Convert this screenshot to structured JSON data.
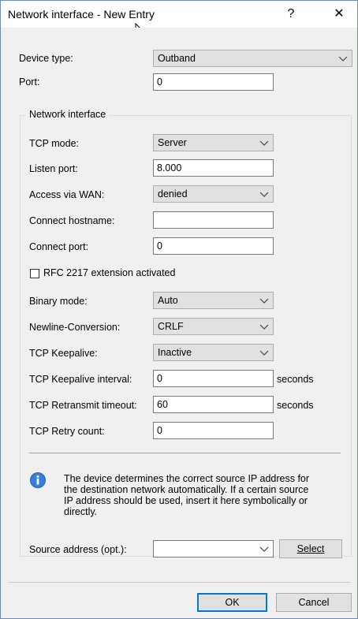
{
  "window": {
    "title": "Network interface - New Entry",
    "help_label": "?",
    "close_label": "✕"
  },
  "device_type": {
    "label": "Device type:",
    "value": "Outband"
  },
  "port": {
    "label": "Port:",
    "value": "0"
  },
  "group": {
    "title": "Network interface",
    "tcp_mode": {
      "label": "TCP mode:",
      "value": "Server"
    },
    "listen_port": {
      "label": "Listen port:",
      "value": "8.000"
    },
    "access_wan": {
      "label": "Access via WAN:",
      "value": "denied"
    },
    "connect_hostname": {
      "label": "Connect hostname:",
      "value": ""
    },
    "connect_port": {
      "label": "Connect port:",
      "value": "0"
    },
    "rfc2217": {
      "label": "RFC 2217 extension activated",
      "checked": false
    },
    "binary_mode": {
      "label": "Binary mode:",
      "value": "Auto"
    },
    "newline": {
      "label": "Newline-Conversion:",
      "value": "CRLF"
    },
    "keepalive": {
      "label": "TCP Keepalive:",
      "value": "Inactive"
    },
    "keepalive_interval": {
      "label": "TCP Keepalive interval:",
      "value": "0",
      "unit": "seconds"
    },
    "retransmit": {
      "label": "TCP Retransmit timeout:",
      "value": "60",
      "unit": "seconds"
    },
    "retry": {
      "label": "TCP Retry count:",
      "value": "0"
    }
  },
  "info": {
    "icon": "info-icon",
    "lines": [
      "The device determines the correct source IP address for",
      "the destination network automatically. If a certain source",
      "IP address should be used, insert it here symbolically or",
      "directly."
    ]
  },
  "source": {
    "label": "Source address (opt.):",
    "value": "",
    "select_label": "Select"
  },
  "footer": {
    "ok_label": "OK",
    "cancel_label": "Cancel"
  },
  "colors": {
    "accent": "#0078d7",
    "info_icon": "#3a7fd5"
  }
}
